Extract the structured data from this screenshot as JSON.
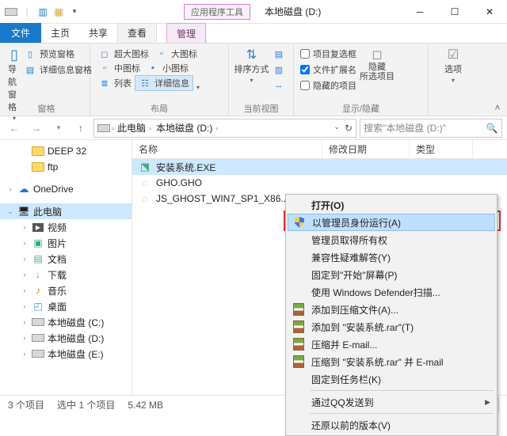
{
  "titlebar": {
    "tools_label": "应用程序工具",
    "title": "本地磁盘 (D:)"
  },
  "tabs": {
    "file": "文件",
    "home": "主页",
    "share": "共享",
    "view": "查看",
    "manage": "管理"
  },
  "ribbon": {
    "panes": {
      "nav_pane": "导航窗格",
      "preview_pane": "预览窗格",
      "details_pane": "详细信息窗格",
      "group": "窗格"
    },
    "layout": {
      "extra_large": "超大图标",
      "large": "大图标",
      "medium": "中图标",
      "small": "小图标",
      "list": "列表",
      "details": "详细信息",
      "group": "布局"
    },
    "current": {
      "sort": "排序方式",
      "group": "当前视图"
    },
    "showhide": {
      "checkboxes": "项目复选框",
      "extensions": "文件扩展名",
      "hidden": "隐藏的项目",
      "hide_selected": "隐藏\n所选项目",
      "group": "显示/隐藏"
    },
    "options": "选项"
  },
  "breadcrumb": {
    "pc": "此电脑",
    "drive": "本地磁盘 (D:)"
  },
  "search": {
    "placeholder": "搜索\"本地磁盘 (D:)\""
  },
  "nav": {
    "deep32": "DEEP 32",
    "ftp": "ftp",
    "onedrive": "OneDrive",
    "this_pc": "此电脑",
    "videos": "视频",
    "pictures": "图片",
    "documents": "文档",
    "downloads": "下载",
    "music": "音乐",
    "desktop": "桌面",
    "drive_c": "本地磁盘 (C:)",
    "drive_d": "本地磁盘 (D:)",
    "drive_e": "本地磁盘 (E:)"
  },
  "columns": {
    "name": "名称",
    "date": "修改日期",
    "type": "类型"
  },
  "files": {
    "f1": "安装系统.EXE",
    "f2": "GHO.GHO",
    "f3": "JS_GHOST_WIN7_SP1_X86..."
  },
  "context_menu": {
    "open": "打开(O)",
    "run_as_admin": "以管理员身份运行(A)",
    "admin_ownership": "管理员取得所有权",
    "troubleshoot": "兼容性疑难解答(Y)",
    "pin_start": "固定到\"开始\"屏幕(P)",
    "defender": "使用 Windows Defender扫描...",
    "add_to_archive": "添加到压缩文件(A)...",
    "add_to_rar": "添加到 \"安装系统.rar\"(T)",
    "compress_email": "压缩并 E-mail...",
    "compress_rar_email": "压缩到 \"安装系统.rar\" 并 E-mail",
    "pin_taskbar": "固定到任务栏(K)",
    "qq_send": "通过QQ发送到",
    "restore_prev": "还原以前的版本(V)"
  },
  "status": {
    "items": "3 个项目",
    "selected": "选中 1 个项目",
    "size": "5.42 MB"
  }
}
